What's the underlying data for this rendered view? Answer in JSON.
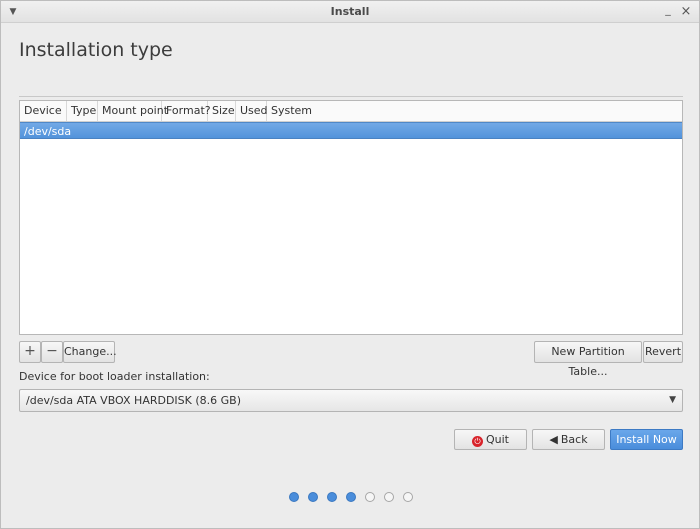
{
  "window": {
    "title": "Install"
  },
  "page": {
    "heading": "Installation type"
  },
  "table": {
    "columns": [
      "Device",
      "Type",
      "Mount point",
      "Format?",
      "Size",
      "Used",
      "System"
    ],
    "rows": [
      {
        "device": "/dev/sda"
      }
    ]
  },
  "toolbar": {
    "add": "+",
    "remove": "−",
    "change": "Change...",
    "new_table": "New Partition Table...",
    "revert": "Revert"
  },
  "bootloader": {
    "label": "Device for boot loader installation:",
    "selected": "/dev/sda  ATA VBOX HARDDISK (8.6 GB)"
  },
  "actions": {
    "quit": "Quit",
    "back": "Back",
    "install": "Install Now"
  },
  "progress": {
    "total_steps": 7,
    "completed_steps": 4
  },
  "colors": {
    "accent": "#4a8ddb",
    "quit_icon": "#d8232a"
  }
}
